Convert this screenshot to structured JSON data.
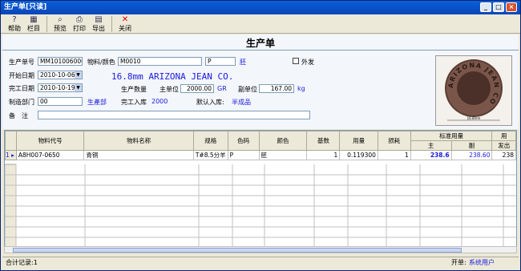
{
  "window": {
    "title": "生产单[只读]"
  },
  "toolbar": {
    "help": "帮助",
    "columns": "栏目",
    "preview": "预览",
    "print": "打印",
    "export": "导出",
    "close": "关闭"
  },
  "form": {
    "title": "生产单",
    "order_no_label": "生产单号",
    "order_no": "MM1010060007",
    "material_label": "物料/颜色",
    "material_code": "M0010",
    "color_code": "P",
    "color_name": "胚",
    "outsource_label": "外发",
    "start_label": "开始日期",
    "start_date": "2010-10-06",
    "finish_label": "完工日期",
    "finish_date": "2010-10-19",
    "dept_label": "制造部门",
    "dept_code": "00",
    "dept_name": "生產部",
    "remark_label": "备　注",
    "remark": "",
    "product_desc": "16.8mm  ARIZONA JEAN CO.",
    "qty_label": "生产数量",
    "main_unit_label": "主单位",
    "main_qty": "2000.00",
    "main_unit": "GR",
    "sub_unit_label": "副单位",
    "sub_qty": "167.00",
    "sub_unit": "kg",
    "finished_label": "完工入库",
    "finished_qty": "2000",
    "default_wh_label": "默认入库:",
    "default_wh": "半成品"
  },
  "image": {
    "ring_text": "ARIZONA JEAN CO",
    "size_caption": "16.8mm"
  },
  "table": {
    "headers": [
      "物料代号",
      "物料名称",
      "规格",
      "色码",
      "颜色",
      "基数",
      "用量",
      "损耗"
    ],
    "std_header": "标准用量",
    "std_main": "主",
    "std_sub": "副",
    "cut_header": "用",
    "cut_sub": "发出",
    "rows": [
      {
        "index": "1",
        "code": "A8H007-0650",
        "name": "青铜",
        "spec": "T#8.5分羊",
        "color_code": "P",
        "color": "胚",
        "base": "1",
        "usage": "0.119300",
        "loss": "1",
        "main": "238.6",
        "sub": "238.60",
        "issued": "238"
      }
    ]
  },
  "status": {
    "total": "合计记录:1",
    "opener_label": "开单:",
    "opener": "系统用户"
  }
}
